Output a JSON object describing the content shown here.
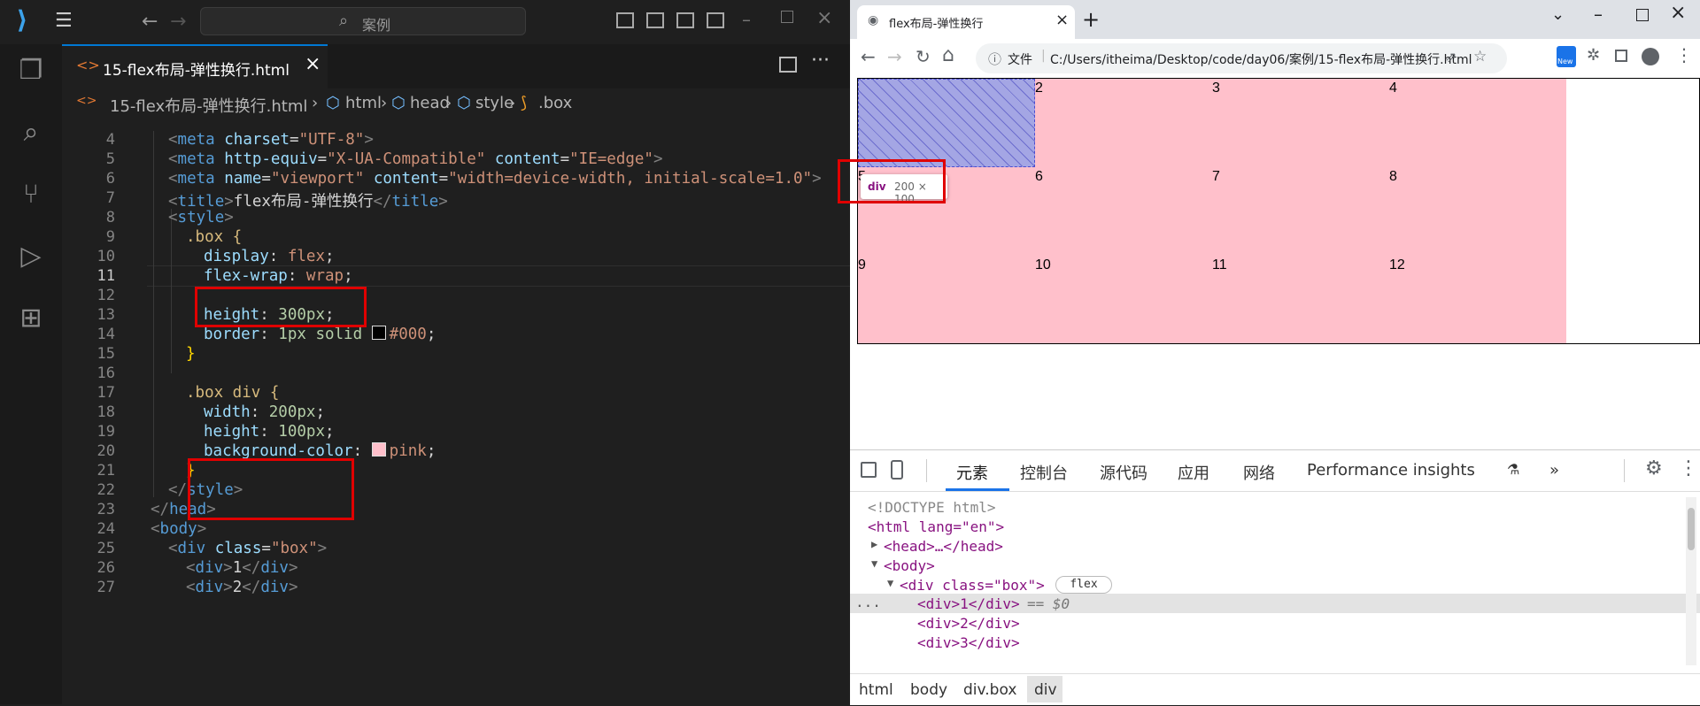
{
  "vscode": {
    "search_placeholder": "案例",
    "tab_label": "15-flex布局-弹性换行.html",
    "breadcrumb": [
      "15-flex布局-弹性换行.html",
      "html",
      "head",
      "style",
      ".box"
    ],
    "line_numbers": [
      "4",
      "5",
      "6",
      "7",
      "8",
      "9",
      "10",
      "11",
      "12",
      "13",
      "14",
      "15",
      "16",
      "17",
      "18",
      "19",
      "20",
      "21",
      "22",
      "23",
      "24",
      "25",
      "26",
      "27"
    ],
    "code": {
      "l4": [
        "<meta charset=\"UTF-8\">"
      ],
      "l5_a": "meta",
      "l5_b": "http-equiv",
      "l5_c": "\"X-UA-Compatible\"",
      "l5_d": "content",
      "l5_e": "\"IE=edge\"",
      "l6_a": "meta",
      "l6_b": "name",
      "l6_c": "\"viewport\"",
      "l6_d": "content",
      "l6_e": "\"width=device-width, initial-scale=1.0\"",
      "l7_tag": "title",
      "l7_text": "flex布局-弹性换行",
      "l8": "style",
      "l9": ".box {",
      "l10_p": "display",
      "l10_v": "flex",
      "l11_p": "flex-wrap",
      "l11_v": "wrap",
      "l13_p": "height",
      "l13_v": "300px",
      "l14_p": "border",
      "l14_v1": "1px solid",
      "l14_v2": "#000",
      "l15": "}",
      "l17": ".box div {",
      "l18_p": "width",
      "l18_v": "200px",
      "l19_p": "height",
      "l19_v": "100px",
      "l20_p": "background-color",
      "l20_v": "pink",
      "l21": "}",
      "l22": "style",
      "l23": "head",
      "l24": "body",
      "l25_tag": "div",
      "l25_attr": "class",
      "l25_val": "\"box\"",
      "l26_tag": "div",
      "l26_text": "1",
      "l27_tag": "div",
      "l27_text": "2"
    }
  },
  "browser": {
    "tab_title": "flex布局-弹性换行",
    "url_prefix": "文件",
    "url": "C:/Users/itheima/Desktop/code/day06/案例/15-flex布局-弹性换行.html",
    "new_badge": "New",
    "cells": [
      "1",
      "2",
      "3",
      "4",
      "5",
      "6",
      "7",
      "8",
      "9",
      "10",
      "11",
      "12"
    ],
    "tooltip_tag": "div",
    "tooltip_size": "200 × 100",
    "devtools": {
      "tabs": [
        "元素",
        "控制台",
        "源代码",
        "应用",
        "网络",
        "Performance insights"
      ],
      "more": "»",
      "tree": {
        "doctype": "<!DOCTYPE html>",
        "html": "<html lang=\"en\">",
        "head": "<head>…</head>",
        "body": "<body>",
        "div_box": "<div class=\"box\">",
        "flex_badge": "flex",
        "div1": "<div>1</div>",
        "div1_suffix": "== $0",
        "div2": "<div>2</div>",
        "div3": "<div>3</div>",
        "dots": "..."
      },
      "crumbs": [
        "html",
        "body",
        "div.box",
        "div"
      ]
    }
  },
  "colors": {
    "accent": "#0078d4",
    "pink": "#ffc0cb",
    "highlight_red": "#e00000"
  }
}
